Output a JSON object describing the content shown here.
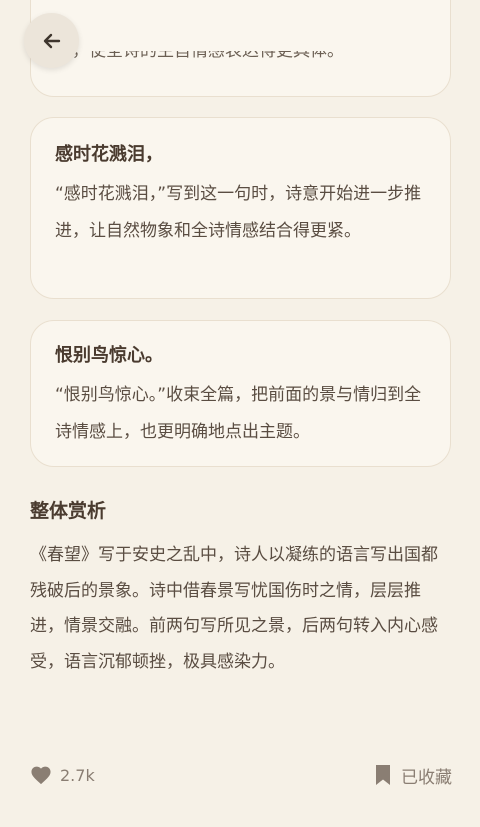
{
  "nav": {
    "back_icon": "arrow-left-icon"
  },
  "cards": [
    {
      "text": "家，使全诗的主旨情感表达得更具体。"
    },
    {
      "title": "感时花溅泪，",
      "text": "“感时花溅泪，”写到这一句时，诗意开始进一步推进，让自然物象和全诗情感结合得更紧。"
    },
    {
      "title": "恨别鸟惊心。",
      "text": "“恨别鸟惊心。”收束全篇，把前面的景与情归到全诗情感上，也更明确地点出主题。"
    }
  ],
  "analysis": {
    "title": "整体赏析",
    "text": "《春望》写于安史之乱中，诗人以凝练的语言写出国都残破后的景象。诗中借春景写忧国伤时之情，层层推进，情景交融。前两句写所见之景，后两句转入内心感受，语言沉郁顿挫，极具感染力。"
  },
  "footer": {
    "like_count": "2.7k",
    "like_icon": "heart-icon",
    "save_label": "已收藏",
    "save_icon": "bookmark-icon"
  },
  "colors": {
    "background": "#f6f1e7",
    "card": "#faf6ee",
    "accent_icon": "#8a7e73"
  }
}
